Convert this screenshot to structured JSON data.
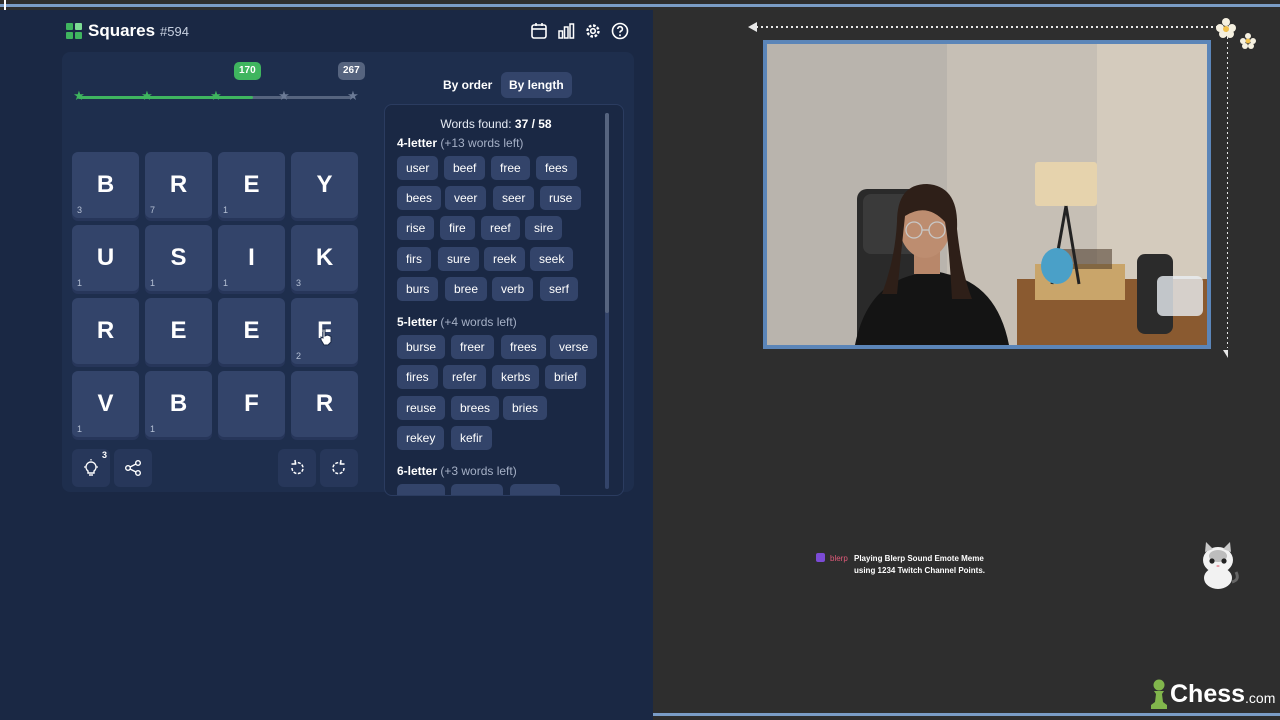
{
  "header": {
    "app_title": "Squares",
    "puzzle_number": "#594",
    "icons": [
      "calendar-icon",
      "stats-icon",
      "settings-icon",
      "help-icon"
    ]
  },
  "progress": {
    "current_score": "170",
    "max_score": "267",
    "stars_earned": 3,
    "stars_total": 5,
    "fill_fraction": 0.64
  },
  "grid": {
    "tiles": [
      {
        "letter": "B",
        "count": "3"
      },
      {
        "letter": "R",
        "count": "7"
      },
      {
        "letter": "E",
        "count": "1"
      },
      {
        "letter": "Y",
        "count": ""
      },
      {
        "letter": "U",
        "count": "1"
      },
      {
        "letter": "S",
        "count": "1"
      },
      {
        "letter": "I",
        "count": "1"
      },
      {
        "letter": "K",
        "count": "3"
      },
      {
        "letter": "R",
        "count": ""
      },
      {
        "letter": "E",
        "count": ""
      },
      {
        "letter": "E",
        "count": ""
      },
      {
        "letter": "F",
        "count": "2"
      },
      {
        "letter": "V",
        "count": "1"
      },
      {
        "letter": "B",
        "count": "1"
      },
      {
        "letter": "F",
        "count": ""
      },
      {
        "letter": "R",
        "count": ""
      }
    ]
  },
  "tools": {
    "hint_count": "3"
  },
  "words_panel": {
    "tab_order": "By order",
    "tab_length": "By length",
    "found_label": "Words found:",
    "found_value": "37 / 58",
    "groups": [
      {
        "title": "4-letter",
        "left": "(+13 words left)",
        "words": [
          "user",
          "beef",
          "free",
          "fees",
          "bees",
          "veer",
          "seer",
          "ruse",
          "rise",
          "fire",
          "reef",
          "sire",
          "firs",
          "sure",
          "reek",
          "seek",
          "burs",
          "bree",
          "verb",
          "serf"
        ]
      },
      {
        "title": "5-letter",
        "left": "(+4 words left)",
        "words": [
          "burse",
          "freer",
          "frees",
          "verse",
          "fires",
          "refer",
          "kerbs",
          "brief",
          "reuse",
          "brees",
          "bries",
          "rekey",
          "kefir"
        ]
      },
      {
        "title": "6-letter",
        "left": "(+3 words left)",
        "words": []
      }
    ]
  },
  "stream": {
    "alert_user": "blerp",
    "alert_line1": "Playing Blerp Sound Emote Meme",
    "alert_line2": "using 1234 Twitch Channel Points.",
    "brand_main": "Chess",
    "brand_tld": ".com"
  },
  "colors": {
    "accent_green": "#3fb55f",
    "panel_bg": "#1a2844",
    "tile_bg": "#33446a",
    "webcam_border": "#5b85b8"
  }
}
